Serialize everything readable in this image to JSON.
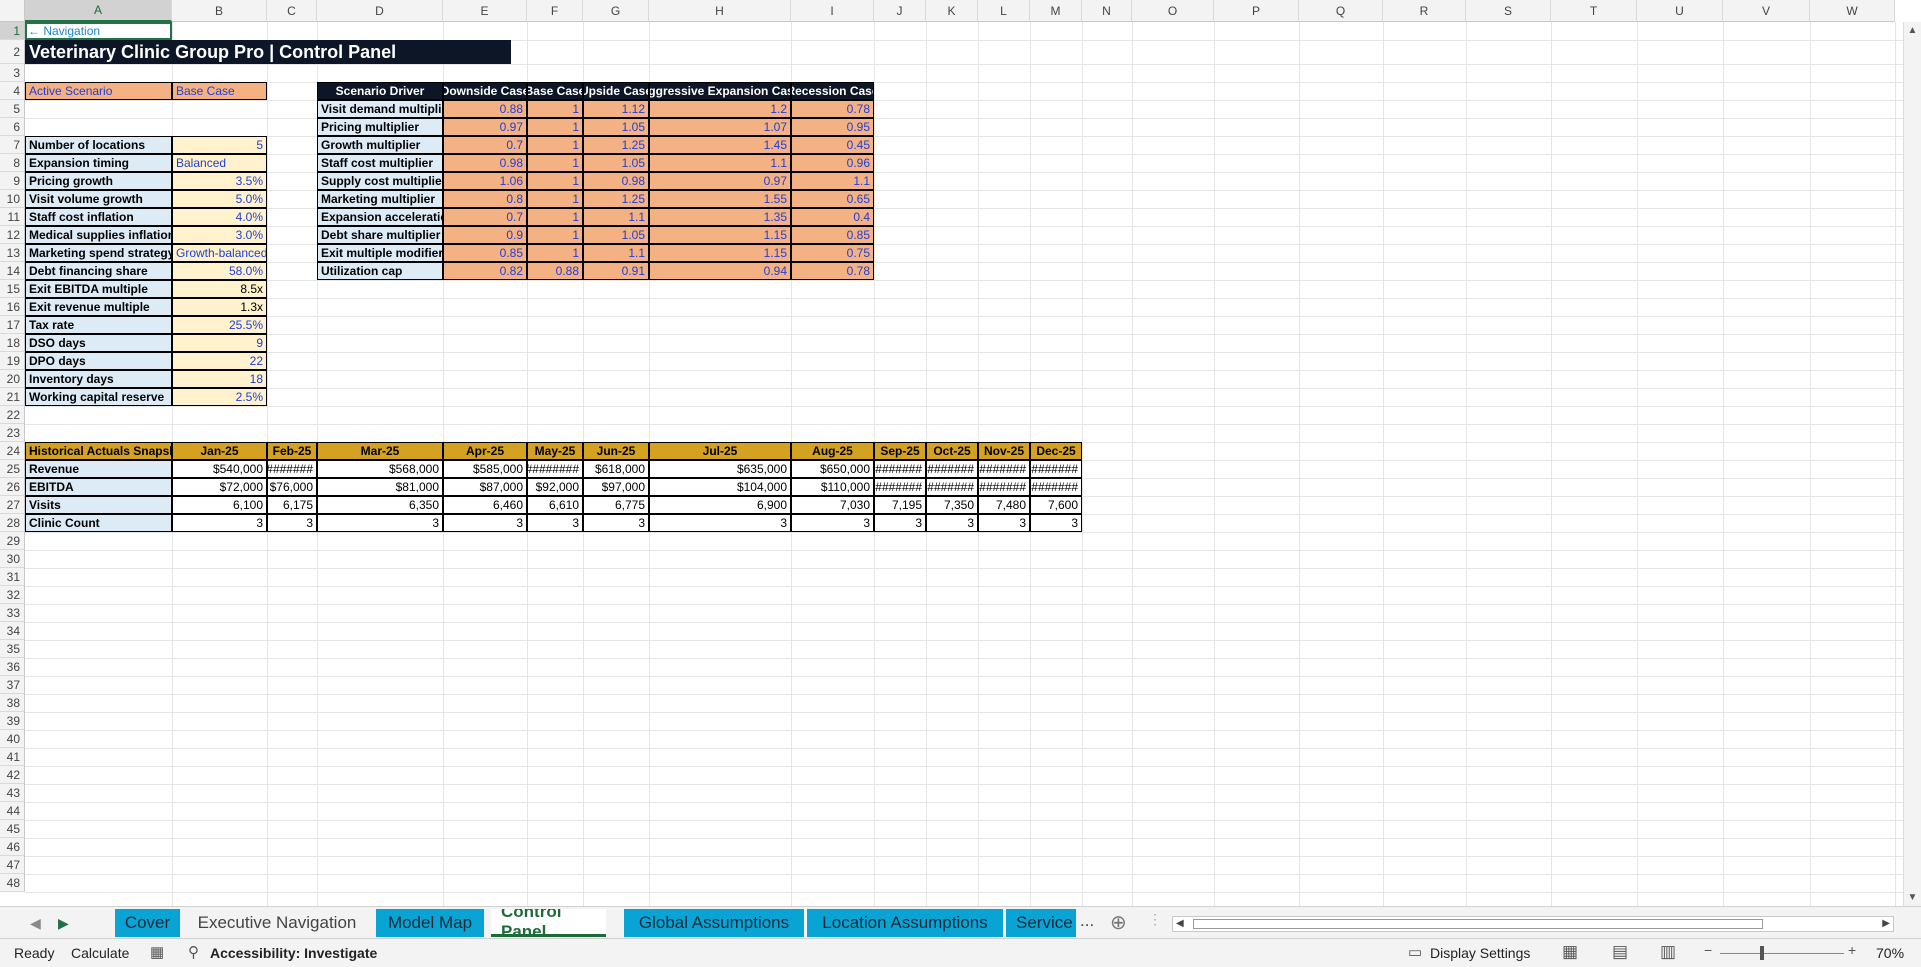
{
  "sheet": {
    "columns": [
      "A",
      "B",
      "C",
      "D",
      "E",
      "F",
      "G",
      "H",
      "I",
      "J",
      "K",
      "L",
      "M",
      "N",
      "O",
      "P",
      "Q",
      "R",
      "S",
      "T",
      "U",
      "V",
      "W"
    ],
    "rows": [
      "1",
      "2",
      "3",
      "4",
      "5",
      "6",
      "7",
      "8",
      "9",
      "10",
      "11",
      "12",
      "13",
      "14",
      "15",
      "16",
      "17",
      "18",
      "19",
      "20",
      "21",
      "22",
      "23",
      "24",
      "25",
      "26",
      "27",
      "28",
      "29",
      "30",
      "31",
      "32",
      "33",
      "34",
      "35",
      "36",
      "37",
      "38",
      "39",
      "40",
      "41",
      "42",
      "43",
      "44",
      "45",
      "46",
      "47",
      "48"
    ]
  },
  "nav_link": "← Navigation",
  "title": "Veterinary Clinic Group Pro | Control Panel",
  "active_scenario": {
    "label": "Active Scenario",
    "value": "Base Case"
  },
  "inputs": [
    {
      "label": "Number of locations",
      "value": "5"
    },
    {
      "label": "Expansion timing",
      "value": "Balanced"
    },
    {
      "label": "Pricing growth",
      "value": "3.5%"
    },
    {
      "label": "Visit volume growth",
      "value": "5.0%"
    },
    {
      "label": "Staff cost inflation",
      "value": "4.0%"
    },
    {
      "label": "Medical supplies inflation",
      "value": "3.0%"
    },
    {
      "label": "Marketing spend strategy",
      "value": "Growth-balanced"
    },
    {
      "label": "Debt financing share",
      "value": "58.0%"
    },
    {
      "label": "Exit EBITDA multiple",
      "value": "8.5x"
    },
    {
      "label": "Exit revenue multiple",
      "value": "1.3x"
    },
    {
      "label": "Tax rate",
      "value": "25.5%"
    },
    {
      "label": "DSO days",
      "value": "9"
    },
    {
      "label": "DPO days",
      "value": "22"
    },
    {
      "label": "Inventory days",
      "value": "18"
    },
    {
      "label": "Working capital reserve",
      "value": "2.5%"
    }
  ],
  "scenario_table": {
    "headers": [
      "Scenario Driver",
      "Downside Case",
      "Base Case",
      "Upside Case",
      "Aggressive Expansion Case",
      "Recession Case"
    ],
    "rows": [
      {
        "driver": "Visit demand multiplie",
        "values": [
          "0.88",
          "1",
          "1.12",
          "1.2",
          "0.78"
        ]
      },
      {
        "driver": "Pricing multiplier",
        "values": [
          "0.97",
          "1",
          "1.05",
          "1.07",
          "0.95"
        ]
      },
      {
        "driver": "Growth multiplier",
        "values": [
          "0.7",
          "1",
          "1.25",
          "1.45",
          "0.45"
        ]
      },
      {
        "driver": "Staff cost multiplier",
        "values": [
          "0.98",
          "1",
          "1.05",
          "1.1",
          "0.96"
        ]
      },
      {
        "driver": "Supply cost multiplier",
        "values": [
          "1.06",
          "1",
          "0.98",
          "0.97",
          "1.1"
        ]
      },
      {
        "driver": "Marketing multiplier",
        "values": [
          "0.8",
          "1",
          "1.25",
          "1.55",
          "0.65"
        ]
      },
      {
        "driver": "Expansion acceleration",
        "values": [
          "0.7",
          "1",
          "1.1",
          "1.35",
          "0.4"
        ]
      },
      {
        "driver": "Debt share multiplier",
        "values": [
          "0.9",
          "1",
          "1.05",
          "1.15",
          "0.85"
        ]
      },
      {
        "driver": "Exit multiple modifier",
        "values": [
          "0.85",
          "1",
          "1.1",
          "1.15",
          "0.75"
        ]
      },
      {
        "driver": "Utilization cap",
        "values": [
          "0.82",
          "0.88",
          "0.91",
          "0.94",
          "0.78"
        ]
      }
    ]
  },
  "historical": {
    "headers": [
      "Historical Actuals Snapshot",
      "Jan-25",
      "Feb-25",
      "Mar-25",
      "Apr-25",
      "May-25",
      "Jun-25",
      "Jul-25",
      "Aug-25",
      "Sep-25",
      "Oct-25",
      "Nov-25",
      "Dec-25"
    ],
    "rows": [
      {
        "label": "Revenue",
        "values": [
          "$540,000",
          "#######",
          "$568,000",
          "$585,000",
          "########",
          "$618,000",
          "$635,000",
          "$650,000",
          "#######",
          "#######",
          "#######",
          "#######"
        ]
      },
      {
        "label": "EBITDA",
        "values": [
          "$72,000",
          "$76,000",
          "$81,000",
          "$87,000",
          "$92,000",
          "$97,000",
          "$104,000",
          "$110,000",
          "#######",
          "#######",
          "#######",
          "#######"
        ]
      },
      {
        "label": "Visits",
        "values": [
          "6,100",
          "6,175",
          "6,350",
          "6,460",
          "6,610",
          "6,775",
          "6,900",
          "7,030",
          "7,195",
          "7,350",
          "7,480",
          "7,600"
        ]
      },
      {
        "label": "Clinic Count",
        "values": [
          "3",
          "3",
          "3",
          "3",
          "3",
          "3",
          "3",
          "3",
          "3",
          "3",
          "3",
          "3"
        ]
      }
    ]
  },
  "tabs": [
    {
      "label": "Cover",
      "style": "blue"
    },
    {
      "label": "Executive Navigation",
      "style": "plain"
    },
    {
      "label": "Model Map",
      "style": "blue"
    },
    {
      "label": "Control Panel",
      "style": "active"
    },
    {
      "label": "Global Assumptions",
      "style": "blue"
    },
    {
      "label": "Location Assumptions",
      "style": "blue"
    },
    {
      "label": "Service",
      "style": "blue"
    }
  ],
  "tab_more": "...",
  "status": {
    "ready": "Ready",
    "calculate": "Calculate",
    "accessibility": "Accessibility: Investigate",
    "display_settings": "Display Settings",
    "zoom": "70%"
  },
  "colors": {
    "dark_header": "#0d1626",
    "gold_header": "#d4a121",
    "salmon": "#f4b183",
    "input_fill": "#fff2cc",
    "label_fill": "#ddebf7",
    "input_text": "#1f3fd6",
    "tab_blue": "#0aa4d4",
    "active_green": "#1e6b3a"
  }
}
